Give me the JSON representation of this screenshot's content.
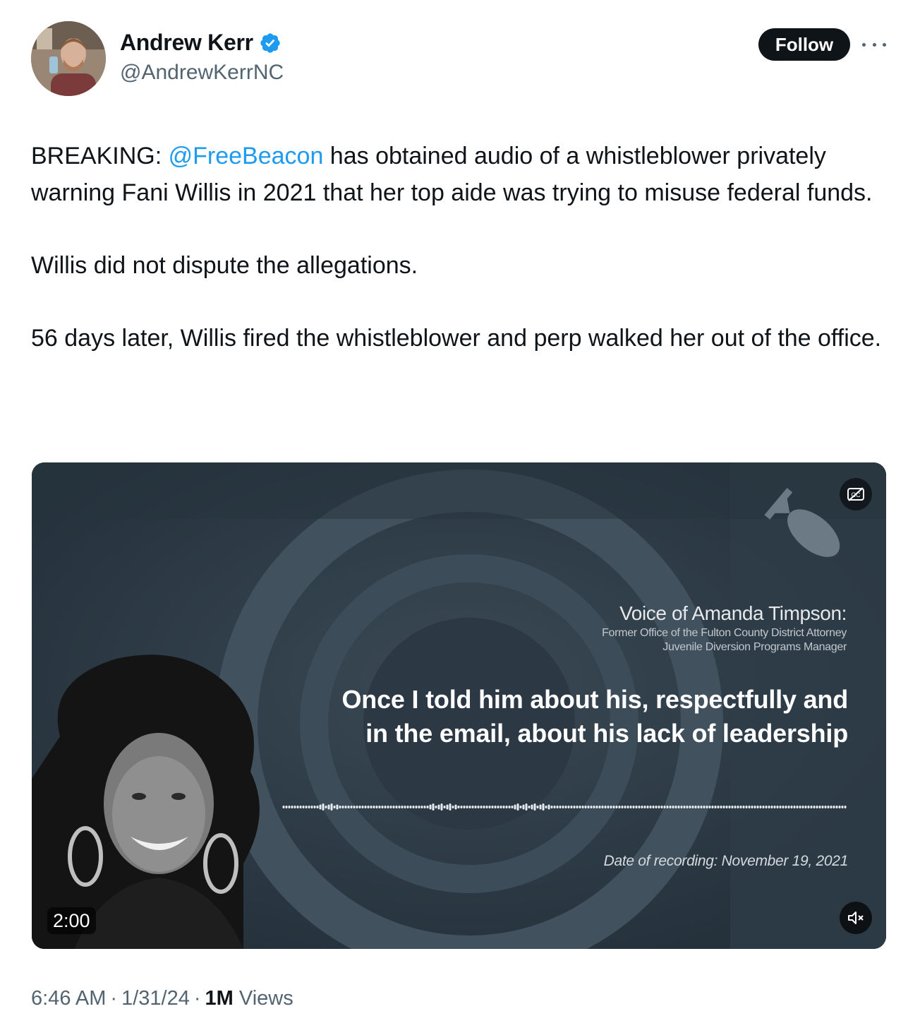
{
  "author": {
    "display_name": "Andrew Kerr",
    "handle": "@AndrewKerrNC",
    "verified": true
  },
  "header": {
    "follow_label": "Follow"
  },
  "tweet": {
    "lead": "BREAKING: ",
    "mention": "@FreeBeacon",
    "paragraph1_rest": " has obtained audio of a whistleblower privately warning Fani Willis in 2021 that her top aide was trying to misuse federal funds.",
    "paragraph2": "Willis did not dispute the allegations.",
    "paragraph3": "56 days later, Willis fired the whistleblower and perp walked her out of the office."
  },
  "media": {
    "voice_title": "Voice of Amanda Timpson:",
    "voice_sub_line1": "Former Office of the Fulton County District Attorney",
    "voice_sub_line2": "Juvenile Diversion Programs Manager",
    "caption_line1": "Once I told him about his, respectfully and",
    "caption_line2": "in the email, about his lack of leadership",
    "recording_date": "Date of recording: November 19, 2021",
    "duration": "2:00",
    "icons": [
      "closed-captions-icon",
      "mute-icon",
      "bomb-logo-icon"
    ]
  },
  "meta": {
    "time": "6:46 AM",
    "date": "1/31/24",
    "views_count": "1M",
    "views_label": " Views"
  },
  "colors": {
    "link": "#1d9bf0",
    "text": "#0f1419",
    "secondary": "#536471",
    "verified": "#1d9bf0",
    "follow_bg": "#0f1419"
  }
}
